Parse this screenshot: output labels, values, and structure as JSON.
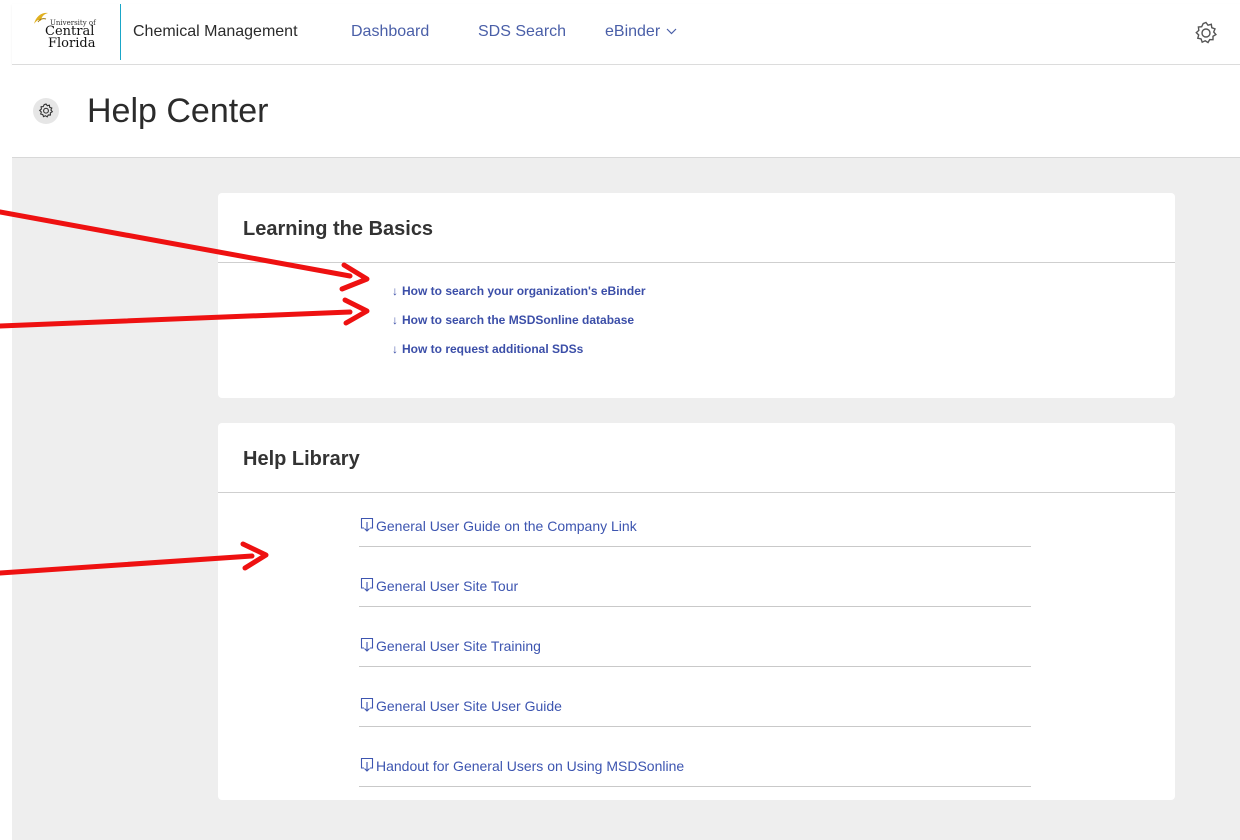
{
  "logo": {
    "small_text": "University of",
    "line1": "Central",
    "line2": "Florida"
  },
  "nav": {
    "app_name": "Chemical Management",
    "dashboard": "Dashboard",
    "sds_search": "SDS Search",
    "ebinder": "eBinder",
    "settings_icon": "gear-icon"
  },
  "header": {
    "title": "Help Center",
    "icon": "gear-icon"
  },
  "basics": {
    "title": "Learning the Basics",
    "links": [
      "How to search your organization's eBinder",
      "How to search the MSDSonline database",
      "How to request additional SDSs"
    ]
  },
  "library": {
    "title": "Help Library",
    "items": [
      "General User Guide on the Company Link",
      "General User Site Tour",
      "General User Site Training",
      "General User Site User Guide",
      "Handout for General Users on Using MSDSonline"
    ]
  },
  "colors": {
    "link": "#3d55b0",
    "nav_link": "#4a5fa8",
    "annotation_arrow": "#ee1111",
    "content_background": "#eeeeee",
    "nav_divider": "#1aa6c8"
  }
}
